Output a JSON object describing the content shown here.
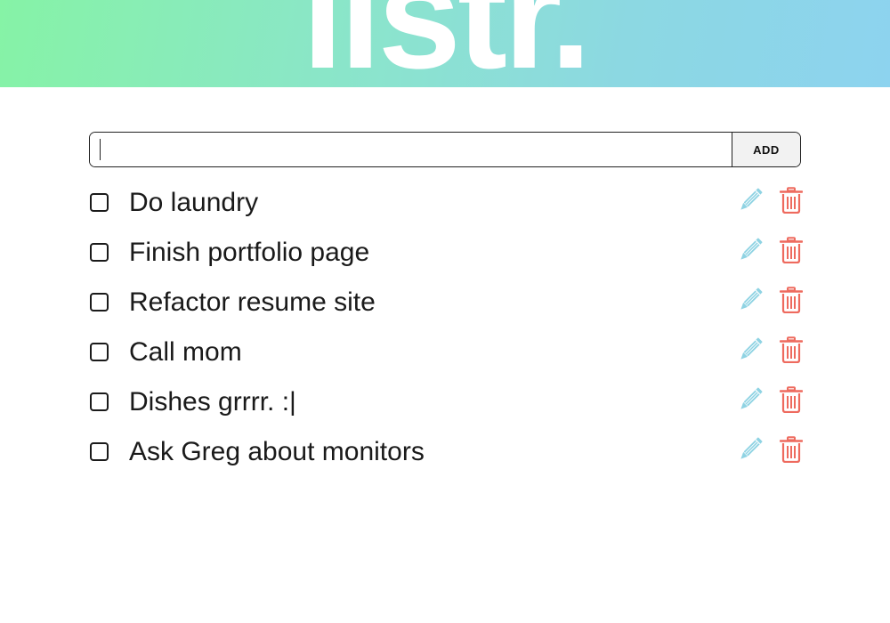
{
  "app": {
    "logo_text": "listr."
  },
  "add_form": {
    "input_value": "",
    "input_placeholder": "",
    "button_label": "ADD"
  },
  "todos": [
    {
      "text": "Do laundry",
      "checked": false
    },
    {
      "text": "Finish portfolio page",
      "checked": false
    },
    {
      "text": "Refactor resume site",
      "checked": false
    },
    {
      "text": "Call mom",
      "checked": false
    },
    {
      "text": "Dishes grrrr. :|",
      "checked": false
    },
    {
      "text": "Ask Greg about monitors",
      "checked": false
    }
  ],
  "icons": {
    "edit": "pencil-icon",
    "delete": "trash-icon"
  },
  "colors": {
    "header_gradient_start": "#86f3a6",
    "header_gradient_end": "#8dd3ef",
    "edit_icon": "#8fd3e3",
    "delete_icon": "#ee6a5e",
    "text": "#1a1a1a"
  }
}
